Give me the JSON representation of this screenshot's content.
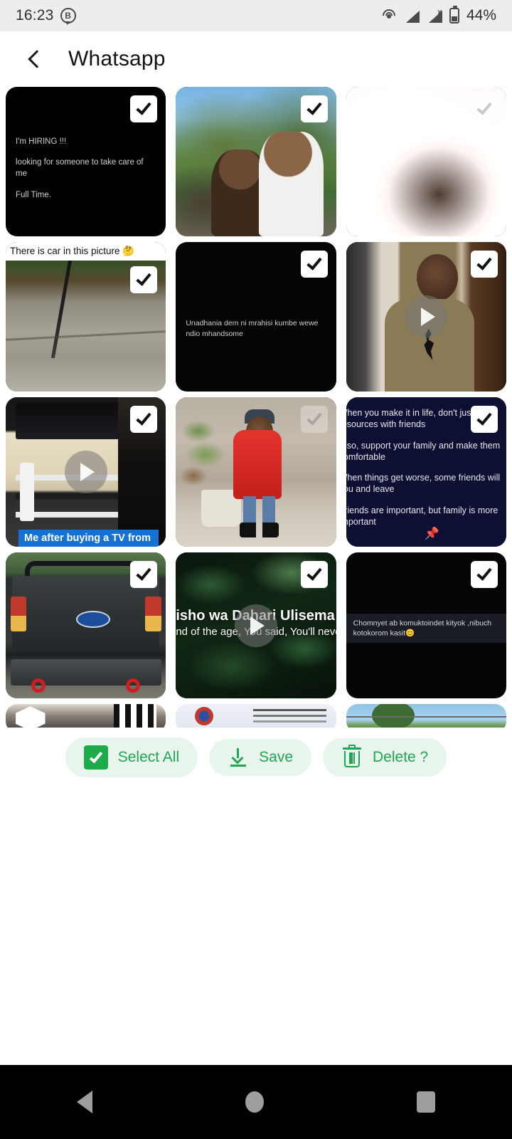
{
  "status_bar": {
    "time": "16:23",
    "badge_letter": "B",
    "battery_percent": "44%",
    "icons": [
      "cast-icon",
      "signal-icon",
      "signal-no-service-icon",
      "battery-icon"
    ]
  },
  "app_bar": {
    "back_icon": "back-chevron-icon",
    "title": "Whatsapp"
  },
  "grid": {
    "items": [
      {
        "id": "tile-1",
        "kind": "text-card",
        "selected": true,
        "lines": [
          "I'm HIRING !!!",
          "looking for someone to take care of me",
          "Full Time."
        ]
      },
      {
        "id": "tile-2",
        "kind": "photo",
        "selected": true,
        "description": "man holding a child outdoors with trees and blue sky"
      },
      {
        "id": "tile-3",
        "kind": "photo",
        "selected": true,
        "checkbox_state": "washed-out",
        "description": "overexposed selfie of a man indoors"
      },
      {
        "id": "tile-4",
        "kind": "photo-with-caption",
        "selected": true,
        "caption_top": "There is car in this picture 🤔",
        "description": "cracked concrete driveway with trees behind"
      },
      {
        "id": "tile-5",
        "kind": "text-card",
        "selected": true,
        "lines": [
          "Unadhania dem ni mrahisi kumbe wewe ndio mhandsome"
        ]
      },
      {
        "id": "tile-6",
        "kind": "video",
        "selected": true,
        "description": "woman in olive Jordan hoodie indoors"
      },
      {
        "id": "tile-7",
        "kind": "video-with-caption",
        "selected": true,
        "caption_bottom": "Me after buying a TV from",
        "description": "TV and home entertainment setup in a room"
      },
      {
        "id": "tile-8",
        "kind": "photo",
        "selected": true,
        "checkbox_state": "washed-out",
        "description": "child in red jacket with backpack standing near potted plants"
      },
      {
        "id": "tile-9",
        "kind": "text-card-navy",
        "selected": true,
        "lines": [
          "When you make it in life, don't just enjoy",
          "resources with friends",
          "Also, support your family and make them",
          "comfortable",
          "When things get worse, some friends will",
          "you and leave",
          "Friends are important, but family is more",
          "important"
        ],
        "emoji": "📌"
      },
      {
        "id": "tile-10",
        "kind": "photo",
        "selected": true,
        "description": "rear view of dark Ford Ranger Raptor pickup truck"
      },
      {
        "id": "tile-11",
        "kind": "video-with-caption",
        "selected": true,
        "caption_line1": "isho wa Dahari Ulisema H",
        "caption_line2": "nd of  the age, You said,  You'll neve",
        "description": "dark green wet leaves background video"
      },
      {
        "id": "tile-12",
        "kind": "text-card",
        "selected": true,
        "lines": [
          "Chomnyet ab komuktoindet kityok ,nibuch kotokorom kasit😊"
        ]
      }
    ],
    "partial_row": [
      {
        "id": "tile-13",
        "description": "dark photo of person, partially visible"
      },
      {
        "id": "tile-14",
        "description": "document with letterhead, partially visible"
      },
      {
        "id": "tile-15",
        "description": "sky and trees photo, partially visible"
      }
    ]
  },
  "action_bar": {
    "select_all": {
      "label": "Select All",
      "icon": "checkbox-checked-icon",
      "checked": true
    },
    "save": {
      "label": "Save",
      "icon": "download-icon"
    },
    "delete": {
      "label": "Delete ?",
      "icon": "trash-icon"
    }
  },
  "nav_bar": {
    "back": "back-triangle-icon",
    "home": "home-circle-icon",
    "recents": "recents-square-icon"
  },
  "colors": {
    "accent_green": "#23a455",
    "pill_bg": "#e7f5ec",
    "status_bg": "#eceded",
    "navy_card": "#0d1033",
    "caption_blue": "#1572d4"
  }
}
